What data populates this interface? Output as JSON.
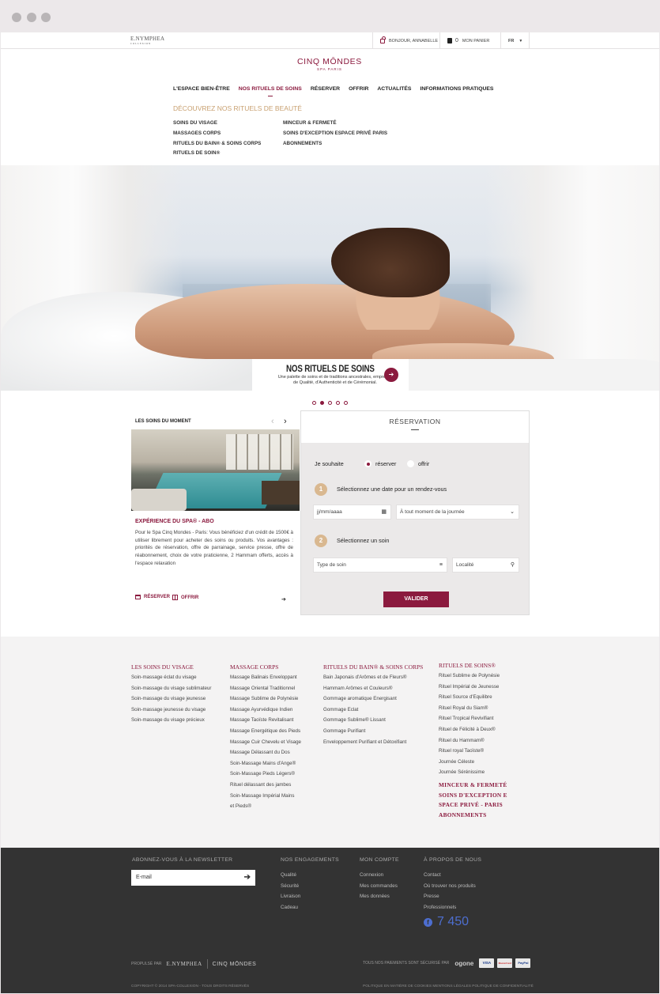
{
  "topbar": {
    "brand": "E.NYMPHEA",
    "brand_sub": "COLLEXION",
    "account": "BONJOUR, ANNABELLE",
    "cart_count": "0",
    "cart_label": "MON PANIER",
    "lang": "FR"
  },
  "logo": {
    "line1": "CINQ MŌNDES",
    "line2": "SPA PARIS"
  },
  "nav": [
    "L'ESPACE BIEN-ÊTRE",
    "NOS RITUELS DE SOINS",
    "RÉSERVER",
    "OFFRIR",
    "ACTUALITÉS",
    "INFORMATIONS PRATIQUES"
  ],
  "submenu": {
    "heading": "DÉCOUVREZ NOS RITUELS DE BEAUTÉ",
    "col1": [
      "SOINS DU VISAGE",
      "MASSAGES CORPS",
      "RITUELS DU BAIN® & SOINS CORPS",
      "RITUELS DE SOIN®"
    ],
    "col2": [
      "MINCEUR & FERMETÉ",
      "SOINS D'EXCEPTION ESPACE PRIVÉ PARIS",
      "ABONNEMENTS"
    ]
  },
  "hero": {
    "title": "NOS RITUELS DE SOINS",
    "desc": "Une palette de soins et de traditions ancestrales, empreints de Qualité, d'Authenticité et de Cérémonial.",
    "arrow": "➔",
    "slide_index": 2,
    "slide_count": 5
  },
  "moment": {
    "heading": "LES SOINS DU MOMENT",
    "prev": "‹",
    "next": "›",
    "title": "EXPÉRIENCE DU SPA® - ABO",
    "text": "Pour le Spa Cinq Mondes - Paris: Vous bénéficiez d'un crédit de 1500€ à utiliser librement pour acheter des soins ou produits. Vos avantages : priorités de réservation, offre de parrainage, service presse, offre de réabonnement, choix de votre praticienne, 2 Hammam offerts, accès à l'espace relaxation",
    "reserve": "RÉSERVER",
    "offer": "OFFRIR",
    "more": "➔"
  },
  "reservation": {
    "heading": "RÉSERVATION",
    "wish": "Je souhaite",
    "opt_reserve": "réserver",
    "opt_offer": "offrir",
    "step1_num": "1",
    "step1": "Sélectionnez une date pour un rendez-vous",
    "date_placeholder": "jj/mm/aaaa",
    "time_value": "À tout moment de la journée",
    "step2_num": "2",
    "step2": "Sélectionnez un soin",
    "soin_placeholder": "Type de soin",
    "locality_placeholder": "Localité",
    "submit": "VALIDER"
  },
  "footer_links": {
    "col1": {
      "title": "LES SOINS DU VISAGE",
      "items": [
        "Soin-massage éclat du visage",
        "Soin-massage du visage sublimateur",
        "Soin-massage du visage jeunesse",
        "Soin-massage jeunesse du visage",
        "Soin-massage  du visage précieux"
      ]
    },
    "col2": {
      "title": "MASSAGE CORPS",
      "items": [
        "Massage Balinais Enveloppant",
        "Massage Oriental Traditionnel",
        "Massage Sublime de Polynésie",
        "Massage Ayurvédique Indien",
        "Massage Taoïste Revitalisant",
        "Massage Energétique des Pieds",
        "Massage Cuir Chevelu et Visage",
        "Massage Délassant du Dos",
        "Soin-Massage Mains d'Ange®",
        "Soin-Massage Pieds Légers®",
        "Rituel délassant des jambes",
        "Soin-Massage Impérial Mains",
        "et Pieds®"
      ]
    },
    "col3": {
      "title": "RITUELS DU BAIN® & SOINS CORPS",
      "items": [
        "Bain Japonais d'Arômes et de Fleurs®",
        "Hammam Arômes et Couleurs®",
        "Gommage aromatique Energisant",
        "Gommage Eclat",
        "Gommage Sublime® Lissant",
        "Gommage Purifiant",
        "Enveloppement Purifiant et Détoxifiant"
      ]
    },
    "col4": {
      "title": "RITUELS DE SOINS®",
      "items": [
        "Rituel Sublime de Polynésie",
        "Rituel Impérial de Jeunesse",
        "Rituel Source d'Equilibre",
        "Rituel Royal du Siam®",
        "Rituel Tropical Revivifiant",
        "Rituel de Félicité à Deux®",
        "Rituel du Hammam®",
        "Rituel royal Taoïste®",
        "Journée Céleste",
        "Journée Sérénissime"
      ],
      "extra": [
        "MINCEUR & FERMETÉ",
        "SOINS D'EXCEPTION E",
        "SPACE PRIVÉ - PARIS",
        "ABONNEMENTS"
      ]
    }
  },
  "dark_footer": {
    "newsletter_title": "ABONNEZ-VOUS À LA NEWSLETTER",
    "newsletter_placeholder": "E-mail",
    "newsletter_go": "➔",
    "engagements_title": "NOS ENGAGEMENTS",
    "engagements": [
      "Qualité",
      "Sécurité",
      "Livraison",
      "Cadeau"
    ],
    "compte_title": "MON COMPTE",
    "compte": [
      "Connexion",
      "Mes commandes",
      "Mes données"
    ],
    "apropos_title": "À PROPOS DE NOUS",
    "apropos": [
      "Contact",
      "Où trouver nos produits",
      "Presse",
      "Professionnels"
    ],
    "fb_count": "7 450",
    "propulse": "PROPULSÉ PAR",
    "propulse_brand1": "E.NYMPHEA",
    "propulse_brand2": "CINQ MŌNDES",
    "payments": "TOUS NOS PAIEMENTS SONT SÉCURISÉ PAR",
    "ogone": "ogone",
    "card1": "VISA",
    "card2": "MasterCard",
    "card3": "PayPal",
    "copyright": "COPYRIGHT © 2014 SPA-COLLEXION - TOUS DROITS RÉSERVÉS",
    "legal": "POLITIQUE EN MATIÈRE DE COOKIES MENTIONS LÉGALES POLITIQUE DE CONFIDENTIALITÉ"
  },
  "colors": {
    "brand": "#8b1a3e",
    "gold": "#d9b890",
    "footer_bg": "#333333"
  }
}
